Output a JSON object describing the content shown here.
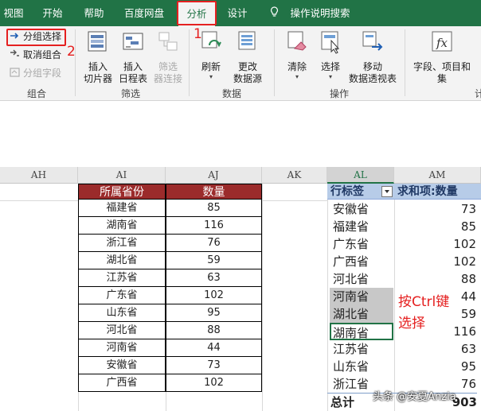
{
  "ribbon_tabs": [
    "视图",
    "开始",
    "帮助",
    "百度网盘",
    "分析",
    "设计"
  ],
  "active_tab": "分析",
  "tell_me": "操作说明搜索",
  "annotations": {
    "tab_marker": "1",
    "cmd_marker": "2"
  },
  "group_section": {
    "label": "组合",
    "commands": [
      "分组选择",
      "取消组合",
      "分组字段"
    ]
  },
  "filter_section": {
    "label": "筛选",
    "buttons": [
      {
        "line1": "插入",
        "line2": "切片器"
      },
      {
        "line1": "插入",
        "line2": "日程表"
      },
      {
        "line1": "筛选",
        "line2": "器连接"
      }
    ]
  },
  "data_section": {
    "label": "数据",
    "buttons": [
      {
        "line1": "刷新",
        "line2": ""
      },
      {
        "line1": "更改",
        "line2": "数据源"
      }
    ]
  },
  "actions_section": {
    "label": "操作",
    "buttons": [
      {
        "line1": "清除",
        "line2": ""
      },
      {
        "line1": "选择",
        "line2": ""
      },
      {
        "line1": "移动",
        "line2": "数据透视表"
      }
    ]
  },
  "calc_section": {
    "label": "计",
    "button": {
      "line1": "字段、项目和",
      "line2": "集"
    }
  },
  "columns": [
    "AH",
    "AI",
    "AJ",
    "AK",
    "AL",
    "AM"
  ],
  "source_table": {
    "headers": [
      "所属省份",
      "数量"
    ],
    "rows": [
      [
        "福建省",
        "85"
      ],
      [
        "湖南省",
        "116"
      ],
      [
        "浙江省",
        "76"
      ],
      [
        "湖北省",
        "59"
      ],
      [
        "江苏省",
        "63"
      ],
      [
        "广东省",
        "102"
      ],
      [
        "山东省",
        "95"
      ],
      [
        "河北省",
        "88"
      ],
      [
        "河南省",
        "44"
      ],
      [
        "安徽省",
        "73"
      ],
      [
        "广西省",
        "102"
      ]
    ]
  },
  "pivot": {
    "row_label_header": "行标签",
    "value_header": "求和项:数量",
    "rows": [
      [
        "安徽省",
        "73"
      ],
      [
        "福建省",
        "85"
      ],
      [
        "广东省",
        "102"
      ],
      [
        "广西省",
        "102"
      ],
      [
        "河北省",
        "88"
      ],
      [
        "河南省",
        "44"
      ],
      [
        "湖北省",
        "59"
      ],
      [
        "湖南省",
        "116"
      ],
      [
        "江苏省",
        "63"
      ],
      [
        "山东省",
        "95"
      ],
      [
        "浙江省",
        "76"
      ]
    ],
    "total_label": "总计",
    "total_value": "903"
  },
  "note": {
    "line1": "按Ctrl键",
    "line2": "选择"
  },
  "watermark": "头条 @安夏Anzia",
  "colors": {
    "ribbon_green": "#217346",
    "header_red": "#9b2b2b",
    "pivot_blue": "#b7cce8",
    "annotation_red": "#e52020"
  }
}
